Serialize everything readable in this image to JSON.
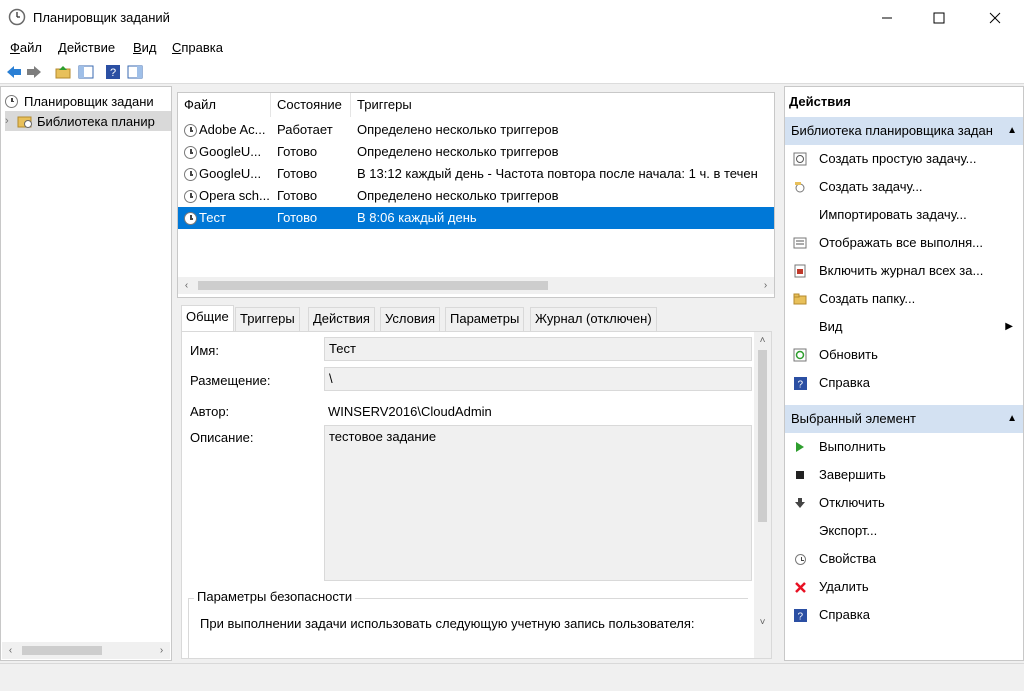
{
  "window": {
    "title": "Планировщик заданий",
    "minimize_glyph": "—",
    "maximize_glyph": "☐",
    "close_glyph": "✕"
  },
  "menu": {
    "file_u": "Ф",
    "file_rest": "айл",
    "action_u": "Д",
    "action_rest": "ействие",
    "view_u": "В",
    "view_rest": "ид",
    "help_u": "С",
    "help_rest": "правка"
  },
  "tree": {
    "root": "Планировщик задани",
    "library": "Библиотека планир"
  },
  "tasks": {
    "columns": [
      "Файл",
      "Состояние",
      "Триггеры"
    ],
    "rows": [
      {
        "name": "Adobe Ac...",
        "status": "Работает",
        "triggers": "Определено несколько триггеров"
      },
      {
        "name": "GoogleU...",
        "status": "Готово",
        "triggers": "Определено несколько триггеров"
      },
      {
        "name": "GoogleU...",
        "status": "Готово",
        "triggers": "В 13:12 каждый день - Частота повтора после начала: 1 ч. в течен"
      },
      {
        "name": "Opera sch...",
        "status": "Готово",
        "triggers": "Определено несколько триггеров"
      },
      {
        "name": "Тест",
        "status": "Готово",
        "triggers": "В 8:06 каждый день"
      }
    ],
    "selected_index": 4
  },
  "details": {
    "tabs": [
      "Общие",
      "Триггеры",
      "Действия",
      "Условия",
      "Параметры",
      "Журнал (отключен)"
    ],
    "active_tab": 0,
    "name_label": "Имя:",
    "name_value": "Тест",
    "location_label": "Размещение:",
    "location_value": "\\",
    "author_label": "Автор:",
    "author_value": "WINSERV2016\\CloudAdmin",
    "description_label": "Описание:",
    "description_value": "тестовое задание",
    "security_group": "Параметры безопасности",
    "security_text": "При выполнении задачи использовать следующую учетную запись пользователя:"
  },
  "actions": {
    "header": "Действия",
    "section1": "Библиотека планировщика задан",
    "section1_items": [
      {
        "label": "Создать простую задачу...",
        "icon": "create-basic-task-icon"
      },
      {
        "label": "Создать задачу...",
        "icon": "create-task-icon"
      },
      {
        "label": "Импортировать задачу...",
        "icon": "none"
      },
      {
        "label": "Отображать все выполня...",
        "icon": "display-running-icon"
      },
      {
        "label": "Включить журнал всех за...",
        "icon": "enable-history-icon"
      },
      {
        "label": "Создать папку...",
        "icon": "folder-icon"
      },
      {
        "label": "Вид",
        "icon": "none"
      },
      {
        "label": "Обновить",
        "icon": "refresh-icon"
      },
      {
        "label": "Справка",
        "icon": "help-icon"
      }
    ],
    "section2": "Выбранный элемент",
    "section2_items": [
      {
        "label": "Выполнить",
        "icon": "run-icon"
      },
      {
        "label": "Завершить",
        "icon": "end-icon"
      },
      {
        "label": "Отключить",
        "icon": "disable-icon"
      },
      {
        "label": "Экспорт...",
        "icon": "none"
      },
      {
        "label": "Свойства",
        "icon": "properties-icon"
      },
      {
        "label": "Удалить",
        "icon": "delete-icon"
      },
      {
        "label": "Справка",
        "icon": "help-icon"
      }
    ]
  },
  "colors": {
    "selection": "#0078d7",
    "section_header": "#d3e1f2",
    "delete_red": "#e81123",
    "run_green": "#2e9e2e",
    "help_blue": "#2b4fa3"
  }
}
